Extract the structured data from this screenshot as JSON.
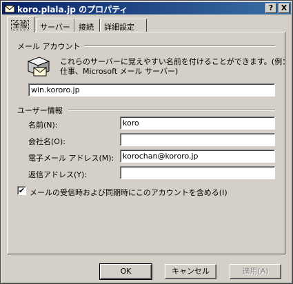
{
  "window": {
    "title": "koro.plala.jp のプロパティ",
    "help_label": "?",
    "close_label": "X"
  },
  "tabs": [
    {
      "label": "全般",
      "active": true
    },
    {
      "label": "サーバー",
      "active": false
    },
    {
      "label": "接続",
      "active": false
    },
    {
      "label": "詳細設定",
      "active": false
    }
  ],
  "mail_account": {
    "group_label": "メール アカウント",
    "description_line1": "これらのサーバーに覚えやすい名前を付けることができます。(例：",
    "description_line2": "仕事、Microsoft メール サーバー)",
    "account_name": "win.kororo.jp",
    "icon": "mail-server-icon"
  },
  "user_info": {
    "group_label": "ユーザー情報",
    "name_label": "名前(N):",
    "name_value": "koro",
    "company_label": "会社名(O):",
    "company_value": "",
    "email_label": "電子メール アドレス(M):",
    "email_value": "korochan@kororo.jp",
    "reply_label": "返信アドレス(Y):",
    "reply_value": ""
  },
  "include_checkbox": {
    "label": "メールの受信時および同期時にこのアカウントを含める(I)",
    "checked": true,
    "check_glyph": "✔"
  },
  "buttons": {
    "ok": "OK",
    "cancel": "キャンセル",
    "apply": "適用(A)"
  }
}
